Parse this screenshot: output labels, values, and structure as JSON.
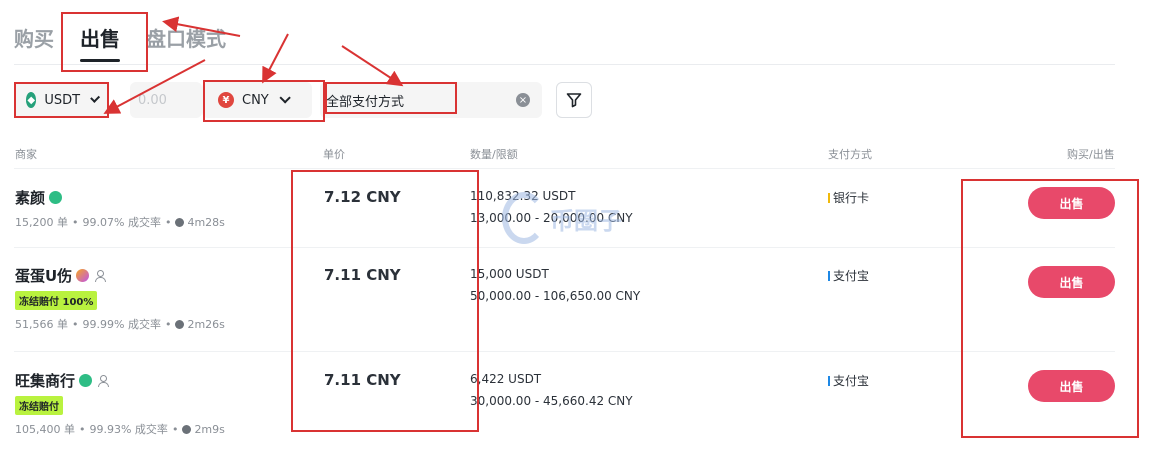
{
  "tabs": [
    "购买",
    "出售",
    "盘口模式"
  ],
  "filters": {
    "coin": "USDT",
    "amount_placeholder": "0.00",
    "currency": "CNY",
    "currency_symbol": "¥",
    "payment": "全部支付方式",
    "clear_symbol": "×"
  },
  "columns": {
    "merchant": "商家",
    "price": "单价",
    "qty": "数量/限额",
    "payment": "支付方式",
    "action": "购买/出售"
  },
  "rows": [
    {
      "name": "素颜",
      "tag": "",
      "orders": "15,200 单",
      "rate": "99.07% 成交率",
      "time": "4m28s",
      "price": "7.12 CNY",
      "amount": "110,832.32 USDT",
      "limit": "13,000.00 - 20,000.00 CNY",
      "pay": "银行卡",
      "button": "出售"
    },
    {
      "name": "蛋蛋U伤",
      "tag": "冻结赔付 100%",
      "orders": "51,566 单",
      "rate": "99.99% 成交率",
      "time": "2m26s",
      "price": "7.11 CNY",
      "amount": "15,000 USDT",
      "limit": "50,000.00 - 106,650.00 CNY",
      "pay": "支付宝",
      "button": "出售"
    },
    {
      "name": "旺集商行",
      "tag": "冻结赔付",
      "orders": "105,400 单",
      "rate": "99.93% 成交率",
      "time": "2m9s",
      "price": "7.11 CNY",
      "amount": "6,422 USDT",
      "limit": "30,000.00 - 45,660.42 CNY",
      "pay": "支付宝",
      "button": "出售"
    }
  ],
  "dot": "•",
  "watermark": "币圈子",
  "colors": {
    "accent_sell": "#e8496a",
    "annotation": "#d93333",
    "tag_bg": "#b9f23f",
    "usdt": "#26a17b",
    "cny": "#e0473f"
  }
}
